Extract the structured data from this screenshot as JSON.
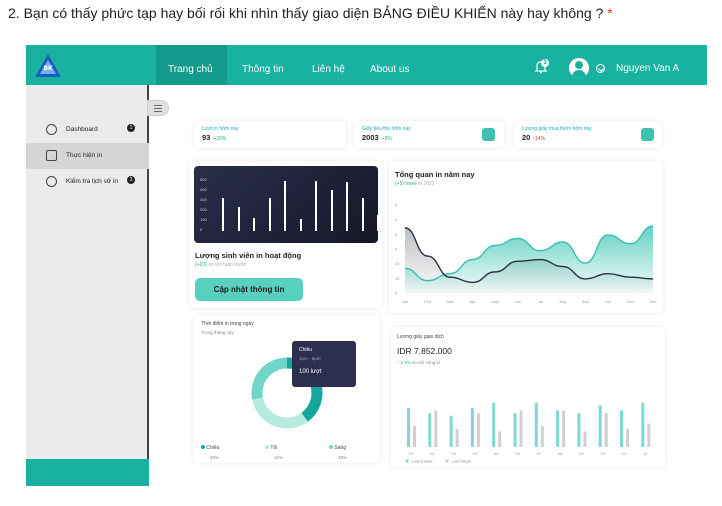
{
  "question": {
    "text": "2. Bạn có thấy phức tạp hay bối rối khi nhìn thấy giao diện BẢNG ĐIỀU KHIỂN này hay không ?",
    "required_mark": "*"
  },
  "brand": {
    "logo_text": "BK",
    "icon": "university-logo-icon"
  },
  "nav": {
    "items": [
      "Trang chủ",
      "Thông tin",
      "Liên hệ",
      "About us"
    ],
    "active": "Trang chủ"
  },
  "header": {
    "notification_count": "3",
    "user_name": "Nguyen Van A"
  },
  "sidebar": {
    "items": [
      {
        "label": "Dashboard",
        "icon": "dashboard-icon",
        "badge": "1",
        "active": false
      },
      {
        "label": "Thực hiện in",
        "icon": "printer-icon",
        "badge": "",
        "active": true
      },
      {
        "label": "Kiểm tra lịch sử in",
        "icon": "history-icon",
        "badge": "3",
        "active": false
      }
    ]
  },
  "stats": [
    {
      "label": "Lượt in hôm nay",
      "value": "93",
      "delta": "+20%",
      "trend": "up",
      "icon": ""
    },
    {
      "label": "Giấy tiêu thụ hôm nay",
      "value": "2003",
      "delta": "+5%",
      "trend": "up",
      "icon": "paper-icon"
    },
    {
      "label": "Lượng giấy mua thêm hôm nay",
      "value": "20",
      "delta": "-14%",
      "trend": "down",
      "icon": "document-icon"
    }
  ],
  "active_students": {
    "title": "Lượng sinh viên in hoạt động",
    "sub_highlight": "(+23)",
    "sub_rest": "so với tuần trước",
    "button": "Cập nhật thông tin",
    "yticks": [
      "500",
      "400",
      "300",
      "200",
      "100",
      "0"
    ]
  },
  "overview": {
    "title": "Tổng quan in năm nay",
    "sub_highlight": "(+5) more",
    "sub_rest": "in 2022",
    "yticks": [
      "5",
      "4",
      "3",
      "2",
      "15",
      "10",
      "0"
    ],
    "months": [
      "Jan",
      "Feb",
      "Mar",
      "Apr",
      "May",
      "Jun",
      "Jul",
      "Aug",
      "Sep",
      "Oct",
      "Nov",
      "Dec"
    ]
  },
  "time_of_day": {
    "title": "Thời điểm in trong ngày",
    "subtitle": "Trong tháng này",
    "tooltip": {
      "label": "Chiều",
      "time": "1pm - 6pm",
      "value": "100 lượt"
    },
    "legend": [
      {
        "label": "Chiều",
        "pct": "40%",
        "color": "#13a89b"
      },
      {
        "label": "Tối",
        "pct": "32%",
        "color": "#b6ecdf"
      },
      {
        "label": "Sáng",
        "pct": "28%",
        "color": "#6fd6c9"
      }
    ]
  },
  "transactions": {
    "title": "Lượng giấy giao dịch",
    "amount": "IDR 7.852.000",
    "delta": "2.1%",
    "delta_rest": "so với cùng kì",
    "xticks": [
      "01",
      "02",
      "03",
      "04",
      "05",
      "06",
      "07",
      "08",
      "09",
      "10",
      "11",
      "12"
    ],
    "legend": [
      "Last 6 days",
      "Last Week"
    ]
  },
  "chart_data": [
    {
      "type": "bar",
      "title": "",
      "yticks": [
        0,
        100,
        200,
        300,
        400,
        500
      ],
      "ylim": [
        0,
        500
      ],
      "values": [
        330,
        240,
        130,
        330,
        500,
        120,
        500,
        410,
        490,
        330,
        160
      ],
      "color": "#ffffff"
    },
    {
      "type": "area",
      "title": "Tổng quan in năm nay",
      "x": [
        "Jan",
        "Feb",
        "Mar",
        "Apr",
        "May",
        "Jun",
        "Jul",
        "Aug",
        "Sep",
        "Oct",
        "Nov",
        "Dec"
      ],
      "ylim": [
        0,
        500
      ],
      "series": [
        {
          "values": [
            140,
            70,
            110,
            190,
            270,
            310,
            240,
            290,
            170,
            330,
            280,
            380
          ],
          "color": "#33c1af"
        },
        {
          "values": [
            370,
            210,
            90,
            60,
            120,
            180,
            190,
            150,
            80,
            110,
            90,
            80
          ],
          "color": "#2b3240"
        }
      ]
    },
    {
      "type": "pie",
      "categories": [
        "Chiều",
        "Tối",
        "Sáng"
      ],
      "values": [
        40,
        32,
        28
      ],
      "colors": [
        "#13a89b",
        "#b6ecdf",
        "#6fd6c9"
      ]
    },
    {
      "type": "bar",
      "title": "Lượng giấy giao dịch",
      "categories": [
        "01",
        "02",
        "03",
        "04",
        "05",
        "06",
        "07",
        "08",
        "09",
        "10",
        "11",
        "12"
      ],
      "series": [
        {
          "name": "Last 6 days",
          "values": [
            75,
            65,
            60,
            75,
            85,
            65,
            85,
            70,
            65,
            80,
            70,
            85
          ],
          "color": "#7fd9cd"
        },
        {
          "name": "Last Week",
          "values": [
            40,
            70,
            35,
            65,
            30,
            70,
            40,
            70,
            30,
            65,
            35,
            45
          ],
          "color": "#d0d0d0"
        }
      ],
      "ylim": [
        0,
        100
      ]
    }
  ]
}
